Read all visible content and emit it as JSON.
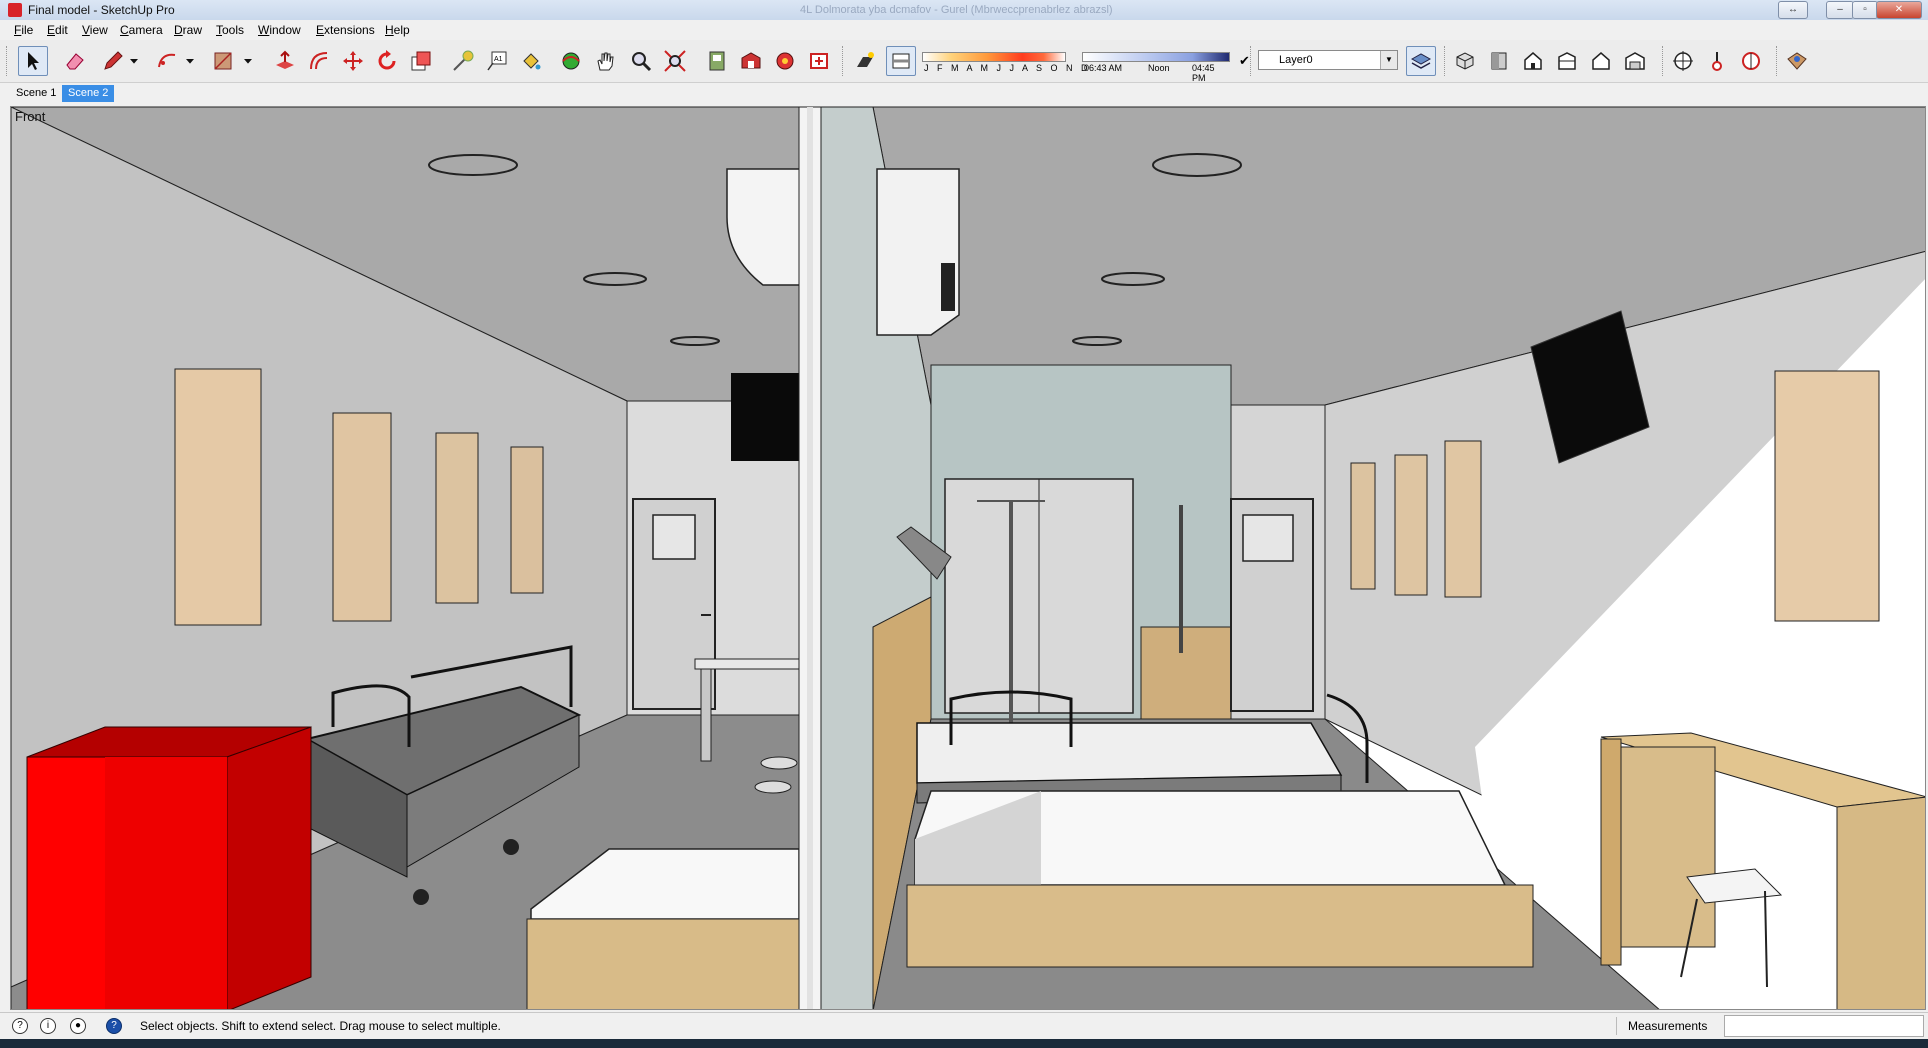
{
  "window": {
    "title": "Final model - SketchUp Pro",
    "ghost_title": "4L Dolmorata yba dcmafov - Gurel (Mbrweccprenabrlez abrazsl)",
    "controls": [
      "↔",
      "–",
      "▫",
      "✕"
    ]
  },
  "menu": [
    "File",
    "Edit",
    "View",
    "Camera",
    "Draw",
    "Tools",
    "Window",
    "Extensions",
    "Help"
  ],
  "toolbar": {
    "tools": [
      {
        "name": "select-tool",
        "icon": "arrow-icon",
        "active": true
      },
      {
        "name": "eraser-tool",
        "icon": "eraser-icon"
      },
      {
        "name": "pencil-tool",
        "icon": "pencil-icon"
      },
      {
        "name": "arc-tool",
        "icon": "arc-icon"
      },
      {
        "name": "rectangle-tool",
        "icon": "rectangle-icon"
      },
      {
        "name": "push-pull-tool",
        "icon": "push-pull-icon"
      },
      {
        "name": "offset-tool",
        "icon": "offset-icon"
      },
      {
        "name": "move-tool",
        "icon": "move-icon"
      },
      {
        "name": "rotate-tool",
        "icon": "rotate-icon"
      },
      {
        "name": "scale-tool",
        "icon": "scale-icon"
      },
      {
        "name": "tape-measure-tool",
        "icon": "tape-icon"
      },
      {
        "name": "text-tool",
        "icon": "text-icon"
      },
      {
        "name": "paint-bucket-tool",
        "icon": "paint-bucket-icon"
      },
      {
        "name": "orbit-tool",
        "icon": "orbit-icon"
      },
      {
        "name": "pan-tool",
        "icon": "hand-icon"
      },
      {
        "name": "zoom-tool",
        "icon": "magnifier-icon"
      },
      {
        "name": "zoom-extents-tool",
        "icon": "zoom-extents-icon"
      },
      {
        "name": "model-info-button",
        "icon": "model-icon"
      },
      {
        "name": "warehouse-button",
        "icon": "warehouse-icon"
      },
      {
        "name": "components-button",
        "icon": "components-icon"
      },
      {
        "name": "extension-warehouse-button",
        "icon": "extension-icon"
      },
      {
        "name": "shadows-toggle",
        "icon": "shadow-icon"
      },
      {
        "name": "fog-toggle",
        "icon": "fog-icon"
      }
    ],
    "months_label": "J F M A M J J A S O N D",
    "time_start": "06:43 AM",
    "time_noon": "Noon",
    "time_end": "04:45 PM",
    "layer_name": "Layer0",
    "views": [
      "iso-view",
      "top-view",
      "front-view",
      "right-view",
      "back-view",
      "left-view"
    ],
    "section_tools": [
      "section-plane-icon",
      "section-cut-icon",
      "section-display-icon",
      "geo-location-icon"
    ]
  },
  "scenes": [
    {
      "label": "Scene 1",
      "active": false
    },
    {
      "label": "Scene 2",
      "active": true
    }
  ],
  "viewport": {
    "view_name": "Front"
  },
  "status": {
    "text": "Select objects. Shift to extend select. Drag mouse to select multiple.",
    "measurements_label": "Measurements",
    "measurements_value": ""
  }
}
